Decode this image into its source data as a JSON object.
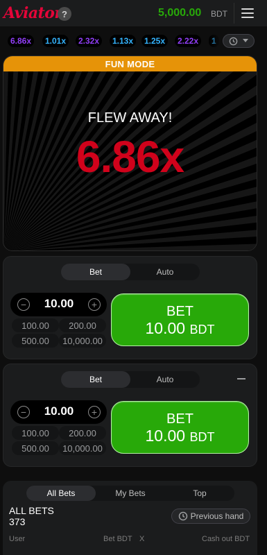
{
  "header": {
    "logo_text": "Aviator",
    "help_label": "?",
    "balance": "5,000.00",
    "currency": "BDT"
  },
  "multipliers": [
    {
      "value": "6.86x",
      "color": "#913ef8"
    },
    {
      "value": "1.01x",
      "color": "#34b4ff"
    },
    {
      "value": "2.32x",
      "color": "#913ef8"
    },
    {
      "value": "1.13x",
      "color": "#34b4ff"
    },
    {
      "value": "1.25x",
      "color": "#34b4ff"
    },
    {
      "value": "2.22x",
      "color": "#913ef8"
    },
    {
      "value": "1",
      "color": "#34b4ff"
    }
  ],
  "game": {
    "mode_label": "FUN MODE",
    "status": "FLEW AWAY!",
    "multiplier": "6.86x",
    "multiplier_color": "#d0021b"
  },
  "bet_panels": [
    {
      "tabs": [
        "Bet",
        "Auto"
      ],
      "active_tab": "Bet",
      "amount": "10.00",
      "quick_amounts": [
        "100.00",
        "200.00",
        "500.00",
        "10,000.00"
      ],
      "button_label": "BET",
      "button_amount": "10.00",
      "button_currency": "BDT"
    },
    {
      "tabs": [
        "Bet",
        "Auto"
      ],
      "active_tab": "Bet",
      "amount": "10.00",
      "quick_amounts": [
        "100.00",
        "200.00",
        "500.00",
        "10,000.00"
      ],
      "button_label": "BET",
      "button_amount": "10.00",
      "button_currency": "BDT"
    }
  ],
  "bets": {
    "tabs": [
      "All Bets",
      "My Bets",
      "Top"
    ],
    "active_tab": "All Bets",
    "title": "ALL BETS",
    "count": "373",
    "previous_hand": "Previous hand",
    "columns": [
      "User",
      "Bet BDT",
      "X",
      "Cash out BDT"
    ]
  },
  "colors": {
    "accent_green": "#28a909",
    "fun_mode_orange": "#e69308",
    "logo_red": "#e50539"
  }
}
